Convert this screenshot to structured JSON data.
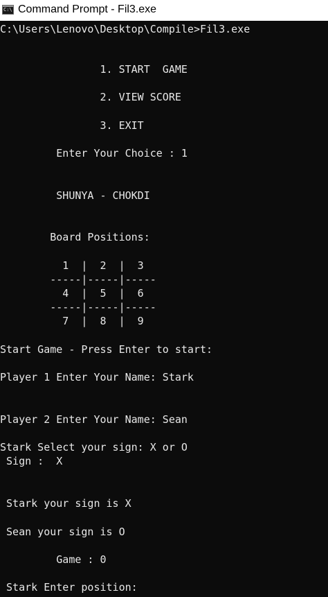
{
  "window": {
    "title": "Command Prompt - Fil3.exe",
    "icon_name": "cmd-icon",
    "icon_text": "C:\\."
  },
  "console": {
    "text_color": "#e8e8e8",
    "background_color": "#0c0c0c",
    "lines": [
      "C:\\Users\\Lenovo\\Desktop\\Compile>Fil3.exe",
      "                1. START  GAME",
      "                2. VIEW SCORE",
      "                3. EXIT",
      "         Enter Your Choice : 1",
      "         SHUNYA - CHOKDI",
      "        Board Positions:",
      "          1  |  2  |  3",
      "        -----|-----|-----",
      "          4  |  5  |  6",
      "        -----|-----|-----",
      "          7  |  8  |  9",
      "Start Game - Press Enter to start:",
      "Player 1 Enter Your Name: Stark",
      "Player 2 Enter Your Name: Sean",
      "Stark Select your sign: X or O",
      " Sign :  X",
      " Stark your sign is X",
      " Sean your sign is O",
      "         Game : 0",
      " Stark Enter position:"
    ]
  }
}
